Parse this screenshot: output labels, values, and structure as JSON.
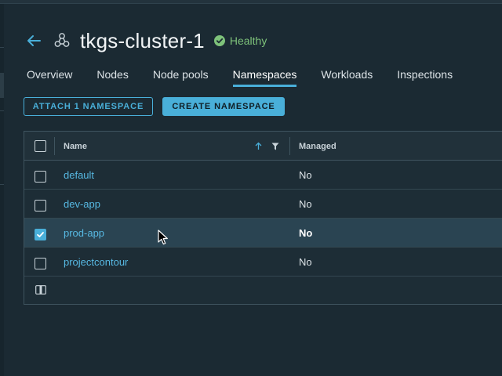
{
  "header": {
    "title": "tkgs-cluster-1",
    "status": "Healthy"
  },
  "tabs": [
    {
      "label": "Overview",
      "active": false
    },
    {
      "label": "Nodes",
      "active": false
    },
    {
      "label": "Node pools",
      "active": false
    },
    {
      "label": "Namespaces",
      "active": true
    },
    {
      "label": "Workloads",
      "active": false
    },
    {
      "label": "Inspections",
      "active": false
    }
  ],
  "actions": {
    "attach_label": "ATTACH 1 NAMESPACE",
    "create_label": "CREATE NAMESPACE"
  },
  "table": {
    "columns": {
      "name": "Name",
      "managed": "Managed"
    },
    "sort": "ascending",
    "rows": [
      {
        "name": "default",
        "managed": "No",
        "checked": false
      },
      {
        "name": "dev-app",
        "managed": "No",
        "checked": false
      },
      {
        "name": "prod-app",
        "managed": "No",
        "checked": true
      },
      {
        "name": "projectcontour",
        "managed": "No",
        "checked": false
      }
    ]
  },
  "colors": {
    "accent": "#49afd9",
    "healthy": "#7ec27a",
    "background": "#1b2a33",
    "selected_row": "#2a4452"
  },
  "icons": {
    "back": "arrow-left-icon",
    "cluster": "cluster-hexagon-icon",
    "status": "check-circle-icon",
    "sort": "arrow-up-icon",
    "filter": "filter-icon",
    "column_toggle": "column-switch-icon"
  }
}
